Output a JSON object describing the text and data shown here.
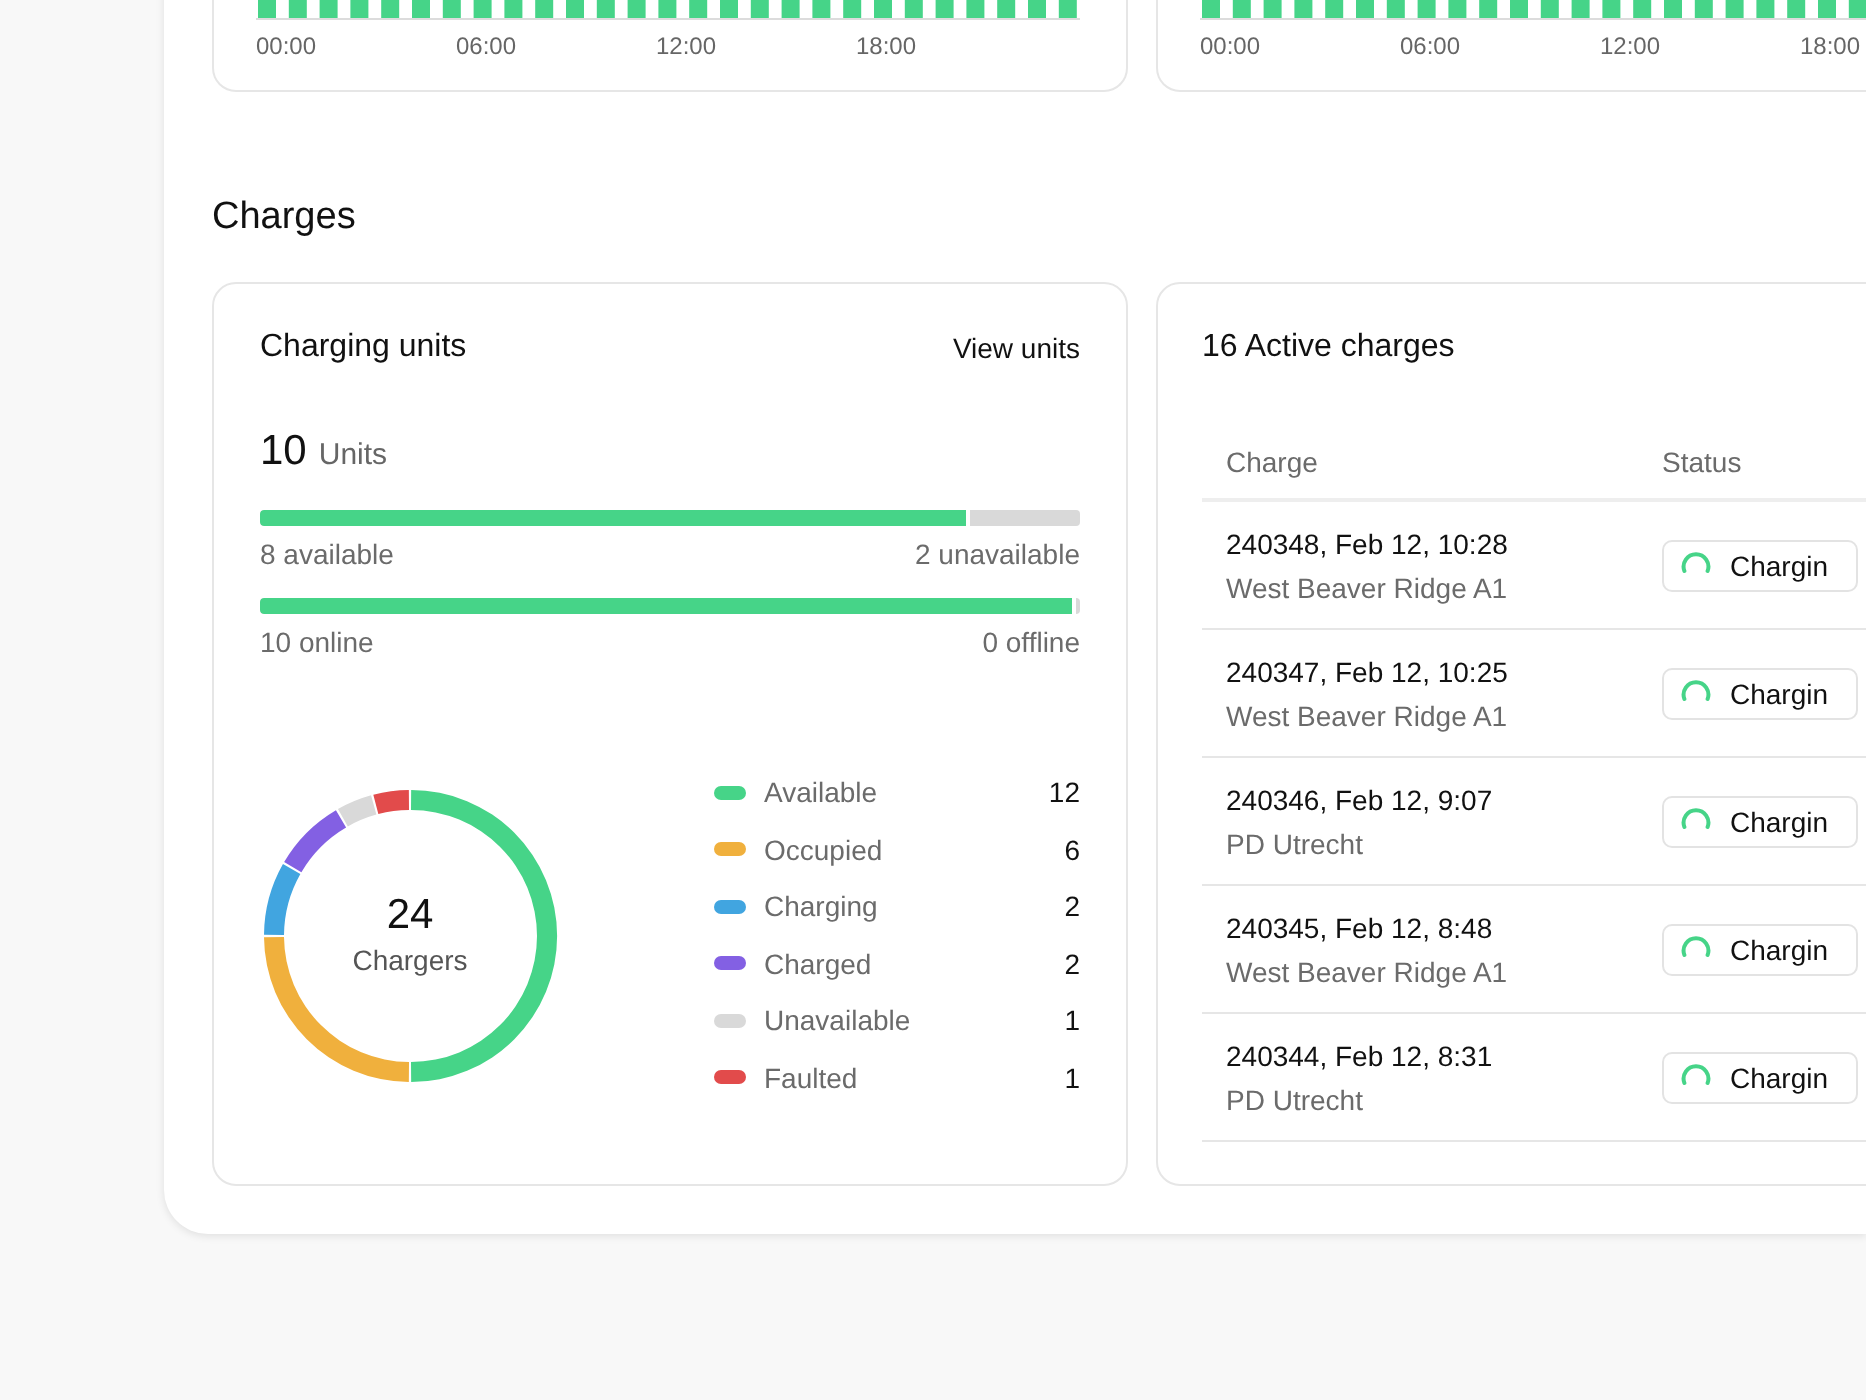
{
  "top_charts": [
    {
      "x_labels": [
        "00:00",
        "06:00",
        "12:00",
        "18:00"
      ]
    },
    {
      "x_labels": [
        "00:00",
        "06:00",
        "12:00",
        "18:00"
      ]
    }
  ],
  "section_title": "Charges",
  "units_card": {
    "title": "Charging units",
    "link": "View units",
    "count": "10",
    "count_unit": "Units",
    "bars": [
      {
        "level": 0.86,
        "left": "8 available",
        "right": "2 unavailable"
      },
      {
        "level": 0.99,
        "left": "10 online",
        "right": "0 offline"
      }
    ],
    "chart_data": {
      "type": "donut",
      "values": [
        50,
        25,
        8.33,
        8.33,
        4.17,
        4.17
      ]
    },
    "donut_total": "24",
    "donut_label": "Chargers",
    "legend": [
      {
        "label": "Available",
        "value": "12",
        "color": "#46d488"
      },
      {
        "label": "Occupied",
        "value": "6",
        "color": "#f0b03d"
      },
      {
        "label": "Charging",
        "value": "2",
        "color": "#41a5e0"
      },
      {
        "label": "Charged",
        "value": "2",
        "color": "#8360e3"
      },
      {
        "label": "Unavailable",
        "value": "1",
        "color": "#d9d9d9"
      },
      {
        "label": "Faulted",
        "value": "1",
        "color": "#e24b4b"
      }
    ]
  },
  "charges_card": {
    "title": "16 Active charges",
    "columns": [
      "Charge",
      "Status"
    ],
    "rows": [
      {
        "charge": "240348, Feb 12, 10:28",
        "location": "West Beaver Ridge A1",
        "status": "Chargin"
      },
      {
        "charge": "240347, Feb 12, 10:25",
        "location": "West Beaver Ridge A1",
        "status": "Chargin"
      },
      {
        "charge": "240346, Feb 12, 9:07",
        "location": "PD Utrecht",
        "status": "Chargin"
      },
      {
        "charge": "240345, Feb 12, 8:48",
        "location": "West Beaver Ridge A1",
        "status": "Chargin"
      },
      {
        "charge": "240344, Feb 12, 8:31",
        "location": "PD Utrecht",
        "status": "Chargin"
      }
    ]
  }
}
